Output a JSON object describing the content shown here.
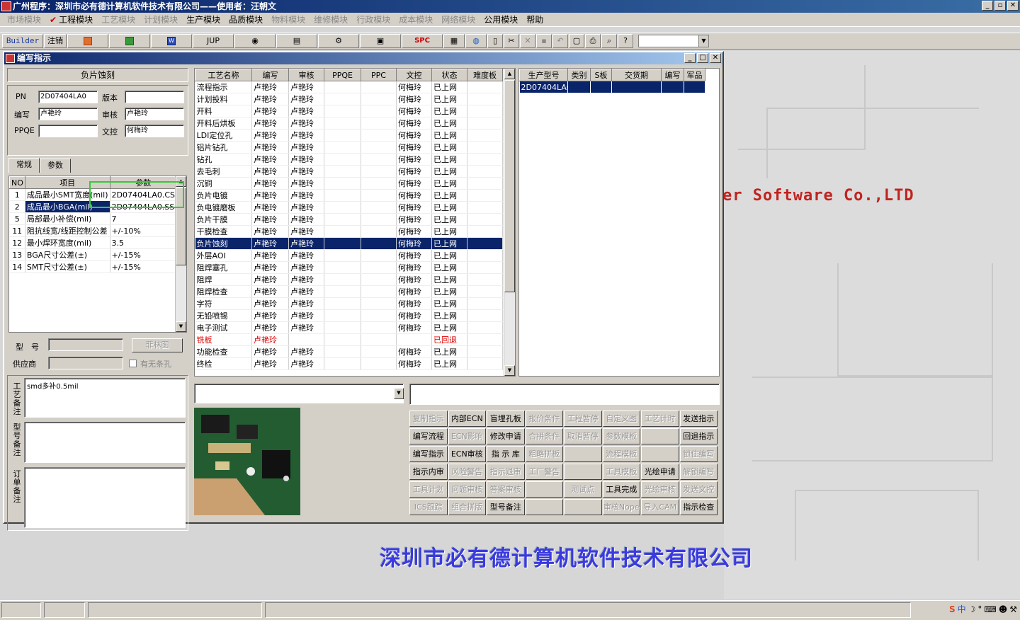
{
  "app": {
    "title": "广州程序：深圳市必有德计算机软件技术有限公司——使用者：汪朝文"
  },
  "menu": [
    {
      "label": "市场模块",
      "enabled": false
    },
    {
      "label": "工程模块",
      "enabled": true,
      "checked": true
    },
    {
      "label": "工艺模块",
      "enabled": false
    },
    {
      "label": "计划模块",
      "enabled": false
    },
    {
      "label": "生产模块",
      "enabled": true
    },
    {
      "label": "品质模块",
      "enabled": true
    },
    {
      "label": "物料模块",
      "enabled": false
    },
    {
      "label": "维修模块",
      "enabled": false
    },
    {
      "label": "行政模块",
      "enabled": false
    },
    {
      "label": "成本模块",
      "enabled": false
    },
    {
      "label": "网络模块",
      "enabled": false
    },
    {
      "label": "公用模块",
      "enabled": true
    },
    {
      "label": "帮助",
      "enabled": true
    }
  ],
  "toolbar": {
    "builder": "Builder",
    "logout": "注销",
    "jup": "JUP",
    "spc": "SPC",
    "icons": [
      "powerpoint-icon",
      "excel-icon",
      "word-icon",
      "eye-icon",
      "database-icon",
      "network-icon",
      "monitor-icon",
      "clipboard-icon",
      "globe-icon",
      "new-doc-icon",
      "cut-icon",
      "delete-icon",
      "save-icon",
      "undo-icon",
      "preview-icon",
      "print-icon",
      "find-icon",
      "help-icon"
    ]
  },
  "child": {
    "title": "编写指示"
  },
  "left": {
    "group_title": "负片蚀刻",
    "pn_label": "PN",
    "pn_value": "2D07404LA0",
    "version_label": "版本",
    "version_value": "",
    "writer_label": "编写",
    "writer_value": "卢艳玲",
    "reviewer_label": "审核",
    "reviewer_value": "卢艳玲",
    "ppqe_label": "PPQE",
    "ppqe_value": "",
    "doc_label": "文控",
    "doc_value": "何梅玲",
    "tabs": [
      "常规",
      "参数"
    ],
    "param_headers": [
      "NO",
      "项目",
      "参数"
    ],
    "params": [
      {
        "no": "1",
        "item": "成品最小SMT宽度(mil)",
        "value": "2D07404LA0.CS"
      },
      {
        "no": "2",
        "item": "成品最小BGA(mil)",
        "value": "2D07404LA0.SS"
      },
      {
        "no": "5",
        "item": "局部最小补偿(mil)",
        "value": "7"
      },
      {
        "no": "11",
        "item": "阻抗线宽/线距控制公差",
        "value": "+/-10%"
      },
      {
        "no": "12",
        "item": "最小焊环宽度(mil)",
        "value": "3.5"
      },
      {
        "no": "13",
        "item": "BGA尺寸公差(±)",
        "value": "+/-15%"
      },
      {
        "no": "14",
        "item": "SMT尺寸公差(±)",
        "value": "+/-15%"
      }
    ],
    "model_label": "型　号",
    "model_value": "",
    "supplier_label": "供应商",
    "supplier_value": "",
    "film_button": "菲林图",
    "no_strip_hole": "有无条孔",
    "process_note_label": "工艺备注",
    "process_note": "smd多补0.5mil",
    "model_note_label": "型号备注",
    "model_note": "",
    "order_note_label": "订单备注",
    "order_note": ""
  },
  "process_grid": {
    "headers": [
      "工艺名称",
      "编写",
      "审核",
      "PPQE",
      "PPC",
      "文控",
      "状态",
      "难度板"
    ],
    "rows": [
      [
        "流程指示",
        "卢艳玲",
        "卢艳玲",
        "",
        "",
        "何梅玲",
        "已上网",
        ""
      ],
      [
        "计划投料",
        "卢艳玲",
        "卢艳玲",
        "",
        "",
        "何梅玲",
        "已上网",
        ""
      ],
      [
        "开料",
        "卢艳玲",
        "卢艳玲",
        "",
        "",
        "何梅玲",
        "已上网",
        ""
      ],
      [
        "开料后烘板",
        "卢艳玲",
        "卢艳玲",
        "",
        "",
        "何梅玲",
        "已上网",
        ""
      ],
      [
        "LDI定位孔",
        "卢艳玲",
        "卢艳玲",
        "",
        "",
        "何梅玲",
        "已上网",
        ""
      ],
      [
        "铝片钻孔",
        "卢艳玲",
        "卢艳玲",
        "",
        "",
        "何梅玲",
        "已上网",
        ""
      ],
      [
        "钻孔",
        "卢艳玲",
        "卢艳玲",
        "",
        "",
        "何梅玲",
        "已上网",
        ""
      ],
      [
        "去毛刺",
        "卢艳玲",
        "卢艳玲",
        "",
        "",
        "何梅玲",
        "已上网",
        ""
      ],
      [
        "沉铜",
        "卢艳玲",
        "卢艳玲",
        "",
        "",
        "何梅玲",
        "已上网",
        ""
      ],
      [
        "负片电镀",
        "卢艳玲",
        "卢艳玲",
        "",
        "",
        "何梅玲",
        "已上网",
        ""
      ],
      [
        "负电镀磨板",
        "卢艳玲",
        "卢艳玲",
        "",
        "",
        "何梅玲",
        "已上网",
        ""
      ],
      [
        "负片干膜",
        "卢艳玲",
        "卢艳玲",
        "",
        "",
        "何梅玲",
        "已上网",
        ""
      ],
      [
        "干膜检查",
        "卢艳玲",
        "卢艳玲",
        "",
        "",
        "何梅玲",
        "已上网",
        ""
      ],
      [
        "负片蚀刻",
        "卢艳玲",
        "卢艳玲",
        "",
        "",
        "何梅玲",
        "已上网",
        ""
      ],
      [
        "外层AOI",
        "卢艳玲",
        "卢艳玲",
        "",
        "",
        "何梅玲",
        "已上网",
        ""
      ],
      [
        "阻焊塞孔",
        "卢艳玲",
        "卢艳玲",
        "",
        "",
        "何梅玲",
        "已上网",
        ""
      ],
      [
        "阻焊",
        "卢艳玲",
        "卢艳玲",
        "",
        "",
        "何梅玲",
        "已上网",
        ""
      ],
      [
        "阻焊检查",
        "卢艳玲",
        "卢艳玲",
        "",
        "",
        "何梅玲",
        "已上网",
        ""
      ],
      [
        "字符",
        "卢艳玲",
        "卢艳玲",
        "",
        "",
        "何梅玲",
        "已上网",
        ""
      ],
      [
        "无铅喷锡",
        "卢艳玲",
        "卢艳玲",
        "",
        "",
        "何梅玲",
        "已上网",
        ""
      ],
      [
        "电子测试",
        "卢艳玲",
        "卢艳玲",
        "",
        "",
        "何梅玲",
        "已上网",
        ""
      ],
      [
        "铣板",
        "卢艳玲",
        "",
        "",
        "",
        "",
        "已回退",
        ""
      ],
      [
        "功能检查",
        "卢艳玲",
        "卢艳玲",
        "",
        "",
        "何梅玲",
        "已上网",
        ""
      ],
      [
        "终检",
        "卢艳玲",
        "卢艳玲",
        "",
        "",
        "何梅玲",
        "已上网",
        ""
      ]
    ],
    "selected_index": 13,
    "red_index": 21
  },
  "model_grid": {
    "headers": [
      "生产型号",
      "类别",
      "S板",
      "交货期",
      "编写",
      "军品"
    ],
    "rows": [
      [
        "2D07404LA0",
        "",
        "",
        "",
        "",
        ""
      ]
    ]
  },
  "actions": [
    [
      "复制指示",
      "内部ECN",
      "盲埋孔板",
      "报价条件",
      "工程暂停",
      "自定义图",
      "工艺计时",
      "发送指示"
    ],
    [
      "编写流程",
      "ECN影响",
      "修改申请",
      "合拼条件",
      "取消暂停",
      "参数模板",
      "",
      "回退指示"
    ],
    [
      "编写指示",
      "ECN审核",
      "指 示 库",
      "粗略拼板",
      "",
      "流程模板",
      "",
      "锁住编写"
    ],
    [
      "指示内审",
      "风险警告",
      "指示退审",
      "工厂警告",
      "",
      "工具模板",
      "光绘申请",
      "解锁编写"
    ],
    [
      "工具计划",
      "问题审核",
      "答案审核",
      "",
      "测试点",
      "工具完成",
      "光绘审核",
      "发送文控"
    ],
    [
      "ICS跟踪",
      "组合拼版",
      "型号备注",
      "",
      "",
      "审核Nope",
      "导入CAM",
      "指示检查"
    ]
  ],
  "actions_enabled": [
    [
      false,
      true,
      true,
      false,
      false,
      false,
      false,
      true
    ],
    [
      true,
      false,
      true,
      false,
      false,
      false,
      false,
      true
    ],
    [
      true,
      true,
      true,
      false,
      false,
      false,
      false,
      false
    ],
    [
      true,
      false,
      false,
      false,
      false,
      false,
      true,
      false
    ],
    [
      false,
      false,
      false,
      false,
      false,
      true,
      false,
      false
    ],
    [
      false,
      false,
      true,
      false,
      false,
      false,
      false,
      true
    ]
  ],
  "brand": {
    "en": "er Software Co.,LTD",
    "cn": "深圳市必有德计算机软件技术有限公司"
  },
  "tray": {
    "ime": "中"
  },
  "colors": {
    "title_bar": "#0a246a",
    "selection": "#0a246a",
    "highlight": "#33cc33",
    "brand_red": "#c0241f",
    "brand_blue": "#3a3adf"
  }
}
